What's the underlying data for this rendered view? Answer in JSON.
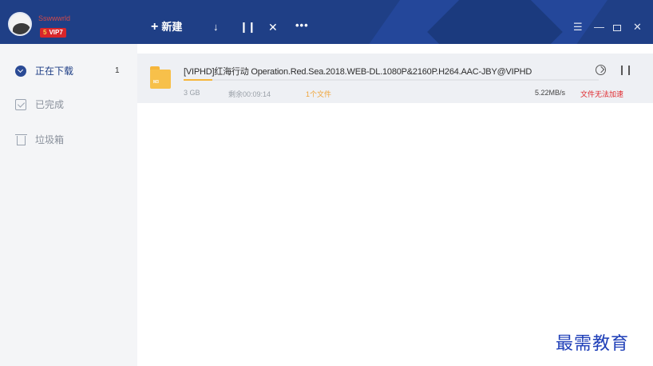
{
  "titlebar": {
    "username": "Sswwwrld",
    "vip_level": "5",
    "vip_label": "VIP7",
    "toolbar": {
      "new_label": "新建",
      "new_icon": "plus-icon",
      "download_icon": "arrow-down-icon",
      "pause_icon": "pause-icon",
      "delete_icon": "close-icon",
      "more_icon": "more-icon"
    },
    "window_controls": [
      "menu-icon",
      "minimize-icon",
      "maximize-icon",
      "close-icon"
    ]
  },
  "sidebar": {
    "items": [
      {
        "label": "正在下载",
        "count": "1",
        "icon": "download-circle-icon",
        "active": true
      },
      {
        "label": "已完成",
        "icon": "checkbox-icon"
      },
      {
        "label": "垃圾箱",
        "icon": "trash-icon"
      }
    ]
  },
  "task": {
    "name": "[VIPHD]红海行动 Operation.Red.Sea.2018.WEB-DL.1080P&2160P.H264.AAC-JBY@VIPHD",
    "size": "3 GB",
    "remaining": "剩余00:09:14",
    "files": "1个文件",
    "speed": "5.22MB/s",
    "status": "文件无法加速",
    "progress_fraction": 0.07,
    "folder_tag": "M3"
  },
  "watermark": "最需教育",
  "colors": {
    "titlebar": "#1f3f86",
    "accent": "#f6b63c",
    "status_red": "#e0282d"
  }
}
